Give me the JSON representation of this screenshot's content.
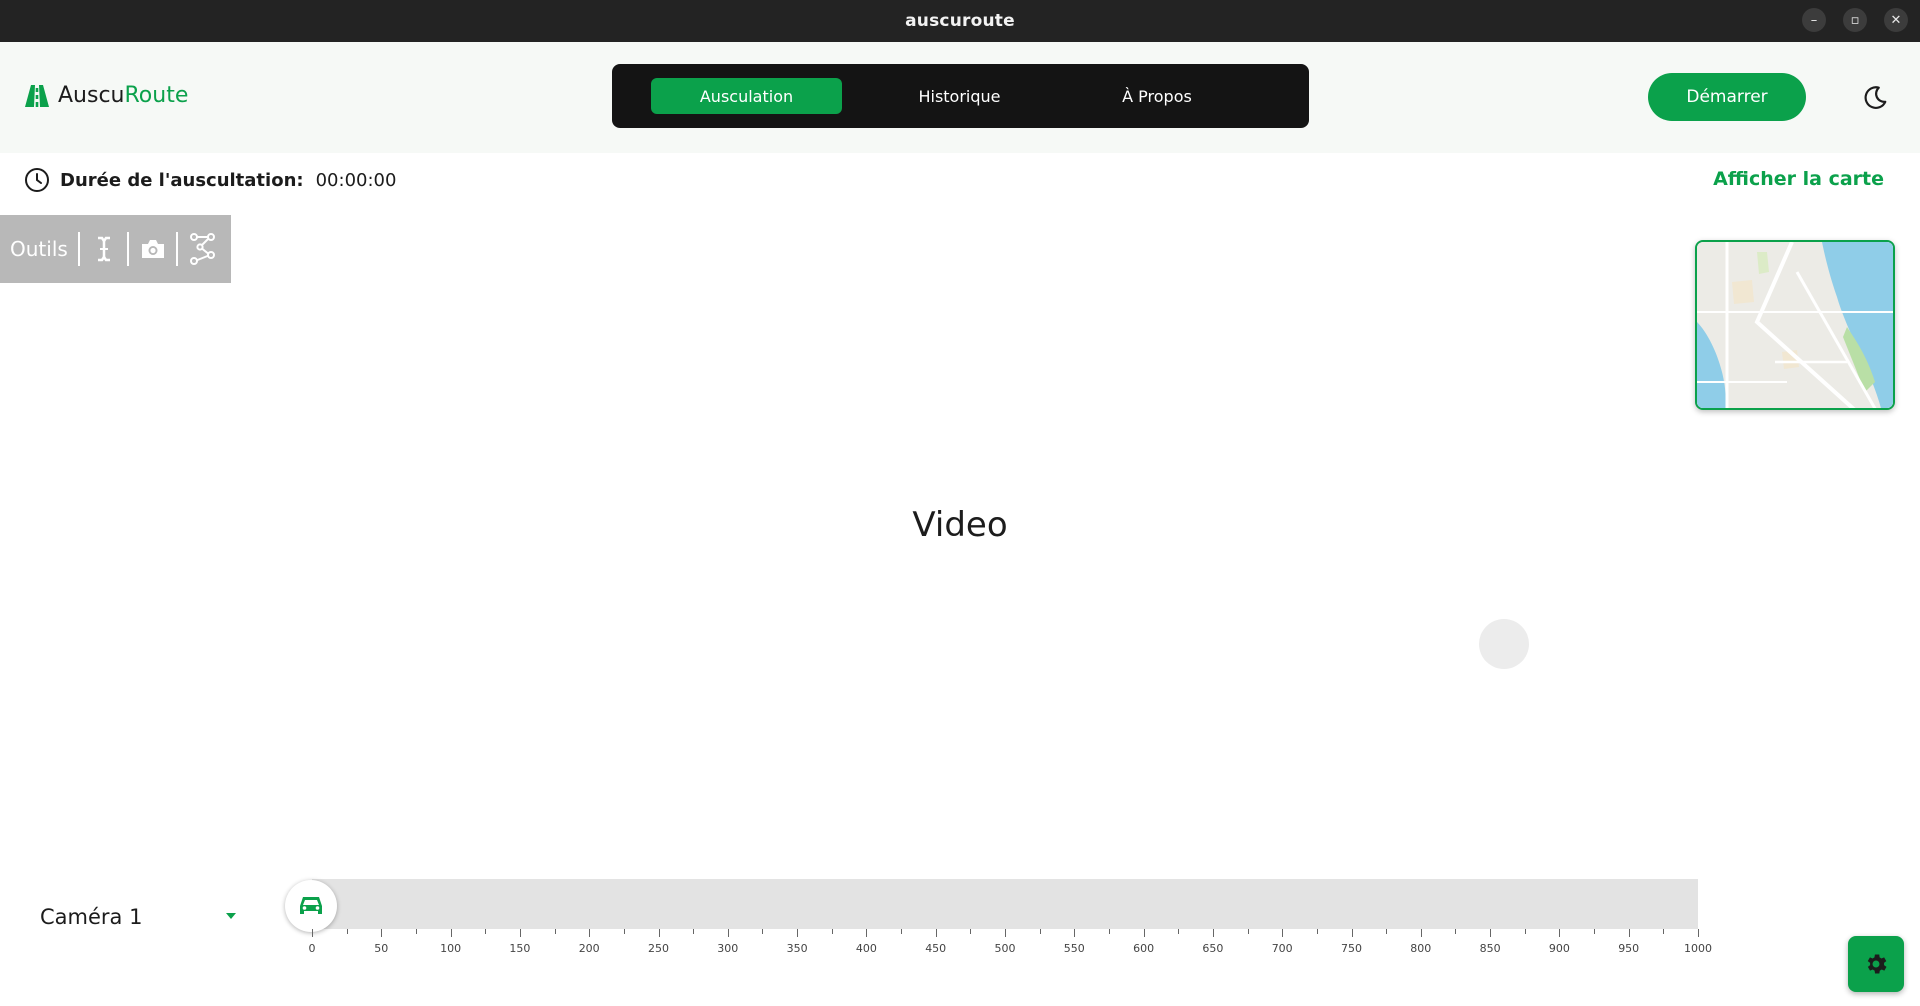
{
  "window": {
    "title": "auscuroute",
    "buttons": [
      "–",
      "▫",
      "✕"
    ]
  },
  "brand": {
    "part1": "Auscu",
    "part2": "Route",
    "icon": "road-icon"
  },
  "nav": {
    "tabs": [
      {
        "label": "Ausculation",
        "active": true
      },
      {
        "label": "Historique",
        "active": false
      },
      {
        "label": "À Propos",
        "active": false
      }
    ]
  },
  "header": {
    "start_label": "Démarrer",
    "theme_icon": "moon-icon"
  },
  "duration": {
    "label": "Durée de l'auscultation:",
    "value": "00:00:00"
  },
  "map_toggle_label": "Afficher la carte",
  "tools": {
    "label": "Outils",
    "icons": [
      "text-cursor-icon",
      "camera-icon",
      "path-nodes-icon"
    ]
  },
  "video": {
    "placeholder": "Video"
  },
  "camera": {
    "selected": "Caméra 1"
  },
  "timeline": {
    "min": 0,
    "max": 1000,
    "major_step": 50,
    "minor_step": 25,
    "position": 0,
    "labels": [
      "0",
      "50",
      "100",
      "150",
      "200",
      "250",
      "300",
      "350",
      "400",
      "450",
      "500",
      "550",
      "600",
      "650",
      "700",
      "750",
      "800",
      "850",
      "900",
      "950",
      "1000"
    ]
  },
  "colors": {
    "accent": "#0ba14b",
    "nav_bg": "#141414",
    "tools_bg": "#b8b8b8"
  }
}
